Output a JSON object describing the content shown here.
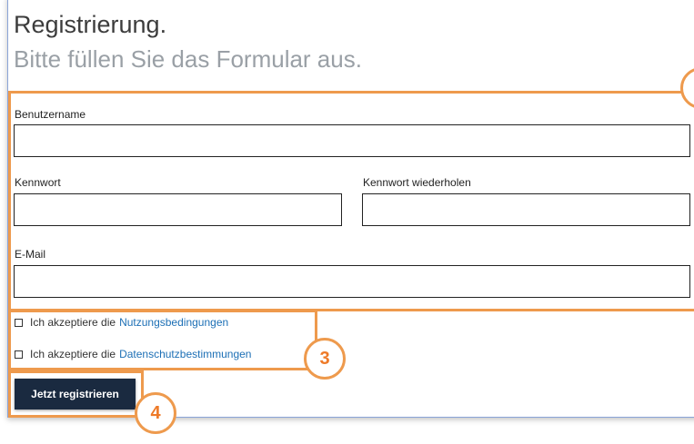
{
  "header": {
    "title": "Registrierung.",
    "subtitle": "Bitte füllen Sie das Formular aus."
  },
  "form": {
    "username_label": "Benutzername",
    "username_value": "",
    "password_label": "Kennwort",
    "password_value": "",
    "password_repeat_label": "Kennwort wiederholen",
    "password_repeat_value": "",
    "email_label": "E-Mail",
    "email_value": ""
  },
  "consents": {
    "terms_prefix": "Ich akzeptiere die",
    "terms_link": "Nutzungsbedingungen",
    "terms_checked": false,
    "privacy_prefix": "Ich akzeptiere die",
    "privacy_link": "Datenschutzbestimmungen",
    "privacy_checked": false
  },
  "submit_label": "Jetzt registrieren",
  "annotations": {
    "badge_consents": "3",
    "badge_submit": "4"
  },
  "colors": {
    "highlight": "#ee9a4d",
    "button_bg": "#1a2a40",
    "link": "#1c6fb5"
  }
}
